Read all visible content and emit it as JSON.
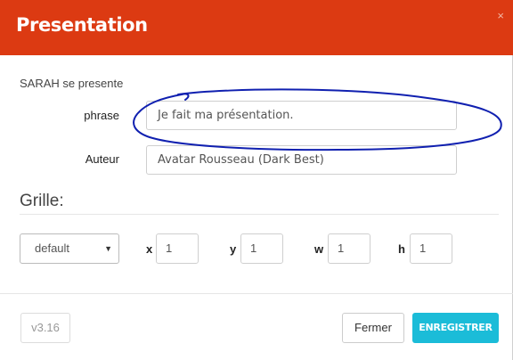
{
  "dialog": {
    "title": "Presentation",
    "close_glyph": "×"
  },
  "subtitle": "SARAH se presente",
  "fields": {
    "phrase_label": "phrase",
    "phrase_value": "Je fait ma présentation.",
    "auteur_label": "Auteur",
    "auteur_value": "Avatar Rousseau (Dark Best)"
  },
  "grille": {
    "title": "Grille:",
    "select_value": "default",
    "x_label": "x",
    "x_value": "1",
    "y_label": "y",
    "y_value": "1",
    "w_label": "w",
    "w_value": "1",
    "h_label": "h",
    "h_value": "1"
  },
  "footer": {
    "version": "v3.16",
    "cancel_label": "Fermer",
    "save_label": "ENREGISTRER"
  },
  "colors": {
    "header": "#dc3a12",
    "save_button": "#1bbcd8",
    "annotation_ink": "#1020b0"
  }
}
